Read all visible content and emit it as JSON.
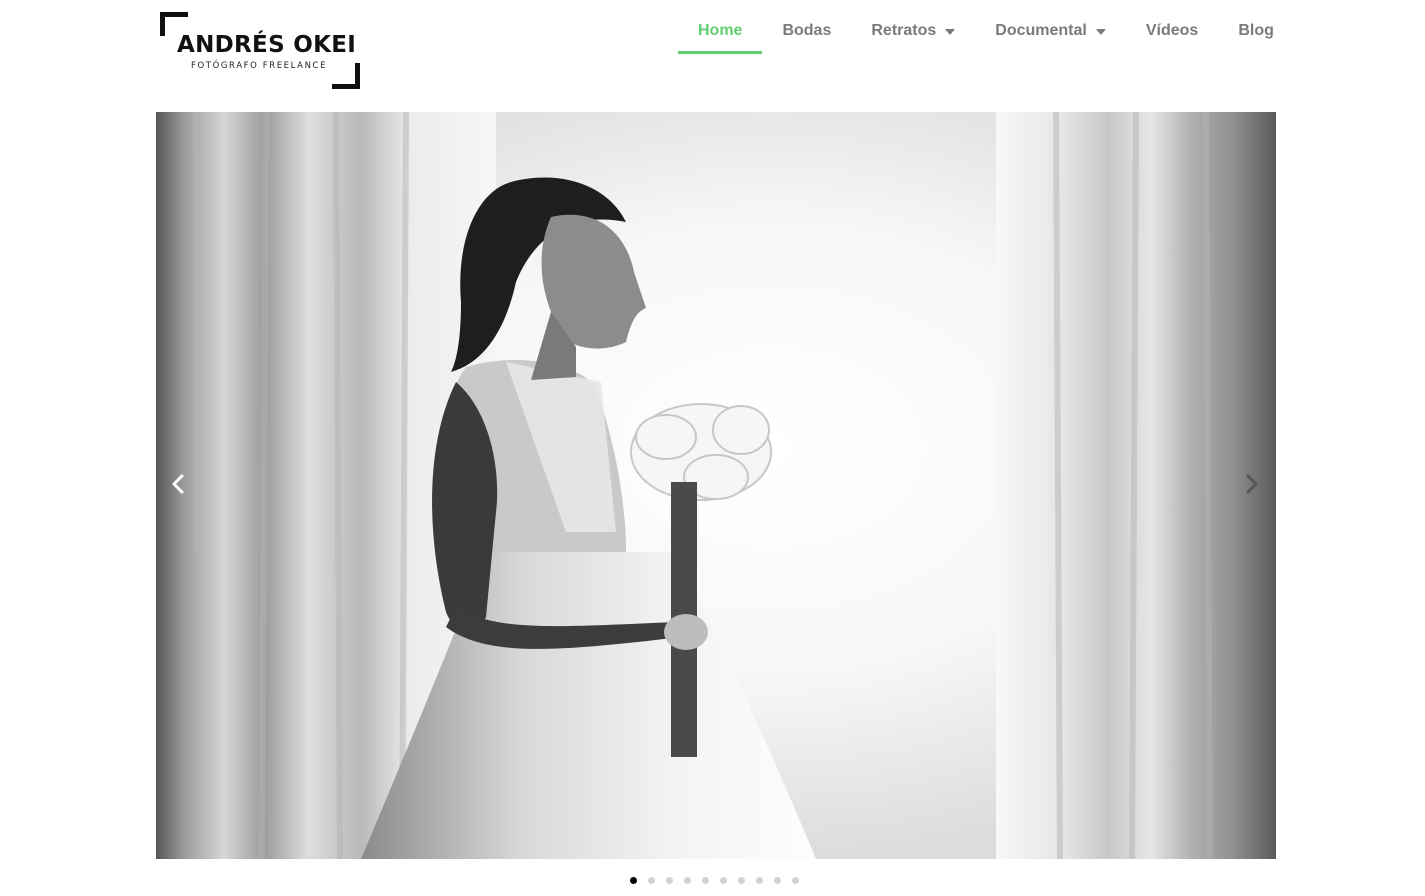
{
  "logo": {
    "name": "ANDRÉS OKEI",
    "subtitle": "FOTÓGRAFO FREELANCE"
  },
  "nav": {
    "items": [
      {
        "label": "Home",
        "active": true,
        "has_dropdown": false
      },
      {
        "label": "Bodas",
        "active": false,
        "has_dropdown": false
      },
      {
        "label": "Retratos",
        "active": false,
        "has_dropdown": true
      },
      {
        "label": "Documental",
        "active": false,
        "has_dropdown": true
      },
      {
        "label": "Vídeos",
        "active": false,
        "has_dropdown": false
      },
      {
        "label": "Blog",
        "active": false,
        "has_dropdown": false
      }
    ]
  },
  "slider": {
    "prev_icon": "chevron-left-icon",
    "next_icon": "chevron-right-icon",
    "slide_count": 10,
    "current_slide": 1
  },
  "colors": {
    "accent": "#61ce70",
    "nav_text": "#7a7a7a",
    "logo": "#111111"
  }
}
